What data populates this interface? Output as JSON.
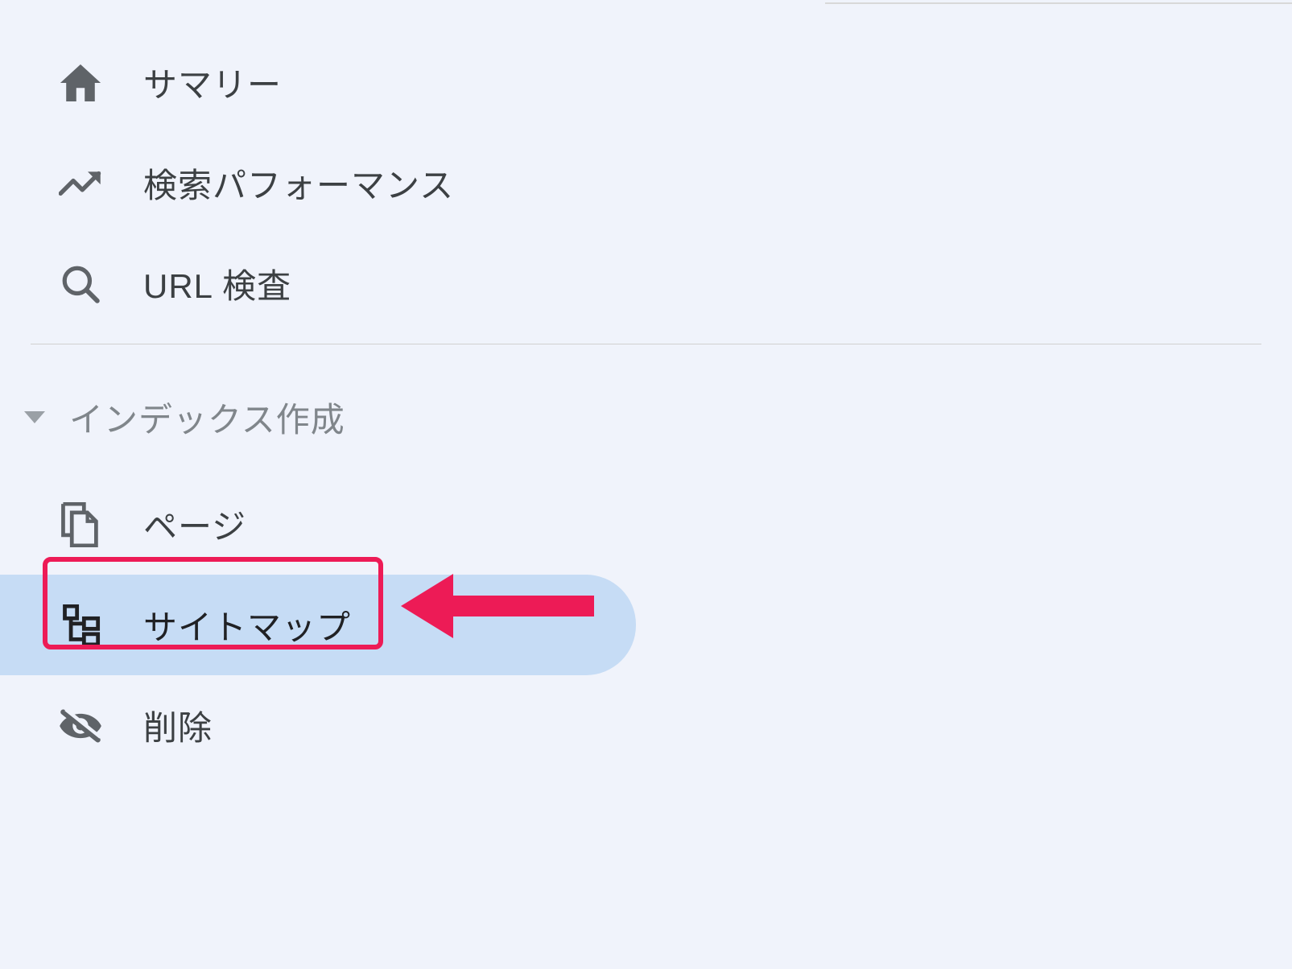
{
  "sidebar": {
    "items": [
      {
        "label": "サマリー"
      },
      {
        "label": "検索パフォーマンス"
      },
      {
        "label": "URL 検査"
      }
    ],
    "section": {
      "label": "インデックス作成",
      "items": [
        {
          "label": "ページ"
        },
        {
          "label": "サイトマップ"
        },
        {
          "label": "削除"
        }
      ]
    }
  }
}
